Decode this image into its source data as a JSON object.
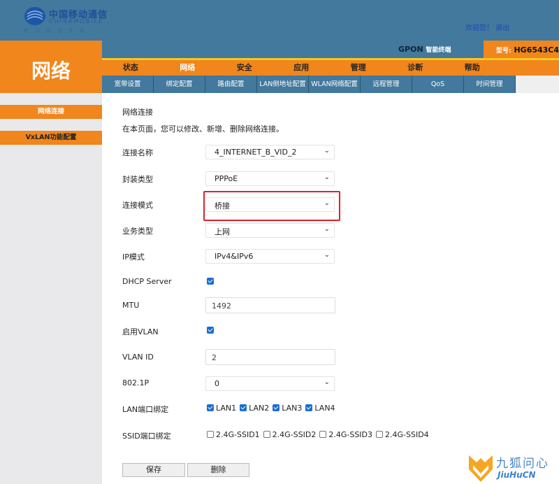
{
  "header": {
    "logo": {
      "cn": "中国移动通信",
      "en": "CHINAMOBILE",
      "sub": "移动通信专家"
    },
    "welcome": "欢迎您！",
    "logout": "退出",
    "product_bold": "GPON",
    "product_rest": "智能终端",
    "model_label": "型号:",
    "model_value": "HG6543C4"
  },
  "section_title": "网络",
  "menu": [
    {
      "label": "状态"
    },
    {
      "label": "网络",
      "active": true
    },
    {
      "label": "安全"
    },
    {
      "label": "应用"
    },
    {
      "label": "管理"
    },
    {
      "label": "诊断"
    },
    {
      "label": "帮助"
    }
  ],
  "submenu": [
    {
      "label": "宽带设置"
    },
    {
      "label": "绑定配置"
    },
    {
      "label": "路由配置"
    },
    {
      "label": "LAN侧地址配置"
    },
    {
      "label": "WLAN网络配置"
    },
    {
      "label": "远程管理"
    },
    {
      "label": "QoS"
    },
    {
      "label": "时间管理"
    }
  ],
  "sidebar": [
    {
      "label": "网络连接",
      "active": true
    },
    {
      "label": "VxLAN功能配置"
    }
  ],
  "main": {
    "title": "网络连接",
    "description": "在本页面，您可以修改、新增、删除网络连接。",
    "fields": {
      "conn_name": {
        "label": "连接名称",
        "value": "4_INTERNET_B_VID_2"
      },
      "encap": {
        "label": "封装类型",
        "value": "PPPoE"
      },
      "mode": {
        "label": "连接模式",
        "value": "桥接"
      },
      "service": {
        "label": "业务类型",
        "value": "上网"
      },
      "ipmode": {
        "label": "IP模式",
        "value": "IPv4&IPv6"
      },
      "dhcp": {
        "label": "DHCP Server",
        "checked": true
      },
      "mtu": {
        "label": "MTU",
        "value": "1492"
      },
      "vlan_enable": {
        "label": "启用VLAN",
        "checked": true
      },
      "vlan_id": {
        "label": "VLAN ID",
        "value": "2"
      },
      "p8021": {
        "label": "802.1P",
        "value": "0"
      },
      "lan_bind": {
        "label": "LAN端口绑定",
        "options": [
          {
            "label": "LAN1",
            "checked": true
          },
          {
            "label": "LAN2",
            "checked": true
          },
          {
            "label": "LAN3",
            "checked": true
          },
          {
            "label": "LAN4",
            "checked": true
          }
        ]
      },
      "ssid_bind": {
        "label": "SSID端口绑定",
        "options": [
          {
            "label": "2.4G-SSID1",
            "checked": false
          },
          {
            "label": "2.4G-SSID2",
            "checked": false
          },
          {
            "label": "2.4G-SSID3",
            "checked": false
          },
          {
            "label": "2.4G-SSID4",
            "checked": false
          }
        ]
      }
    },
    "save": "保存",
    "delete": "删除",
    "highlight_color": "#d9222a"
  },
  "watermark": {
    "cn": "九狐问心",
    "en": "JiuHuCN"
  },
  "colors": {
    "header_blue": "#42799d",
    "accent_orange": "#f0861c",
    "yellow": "#f7c81d"
  }
}
